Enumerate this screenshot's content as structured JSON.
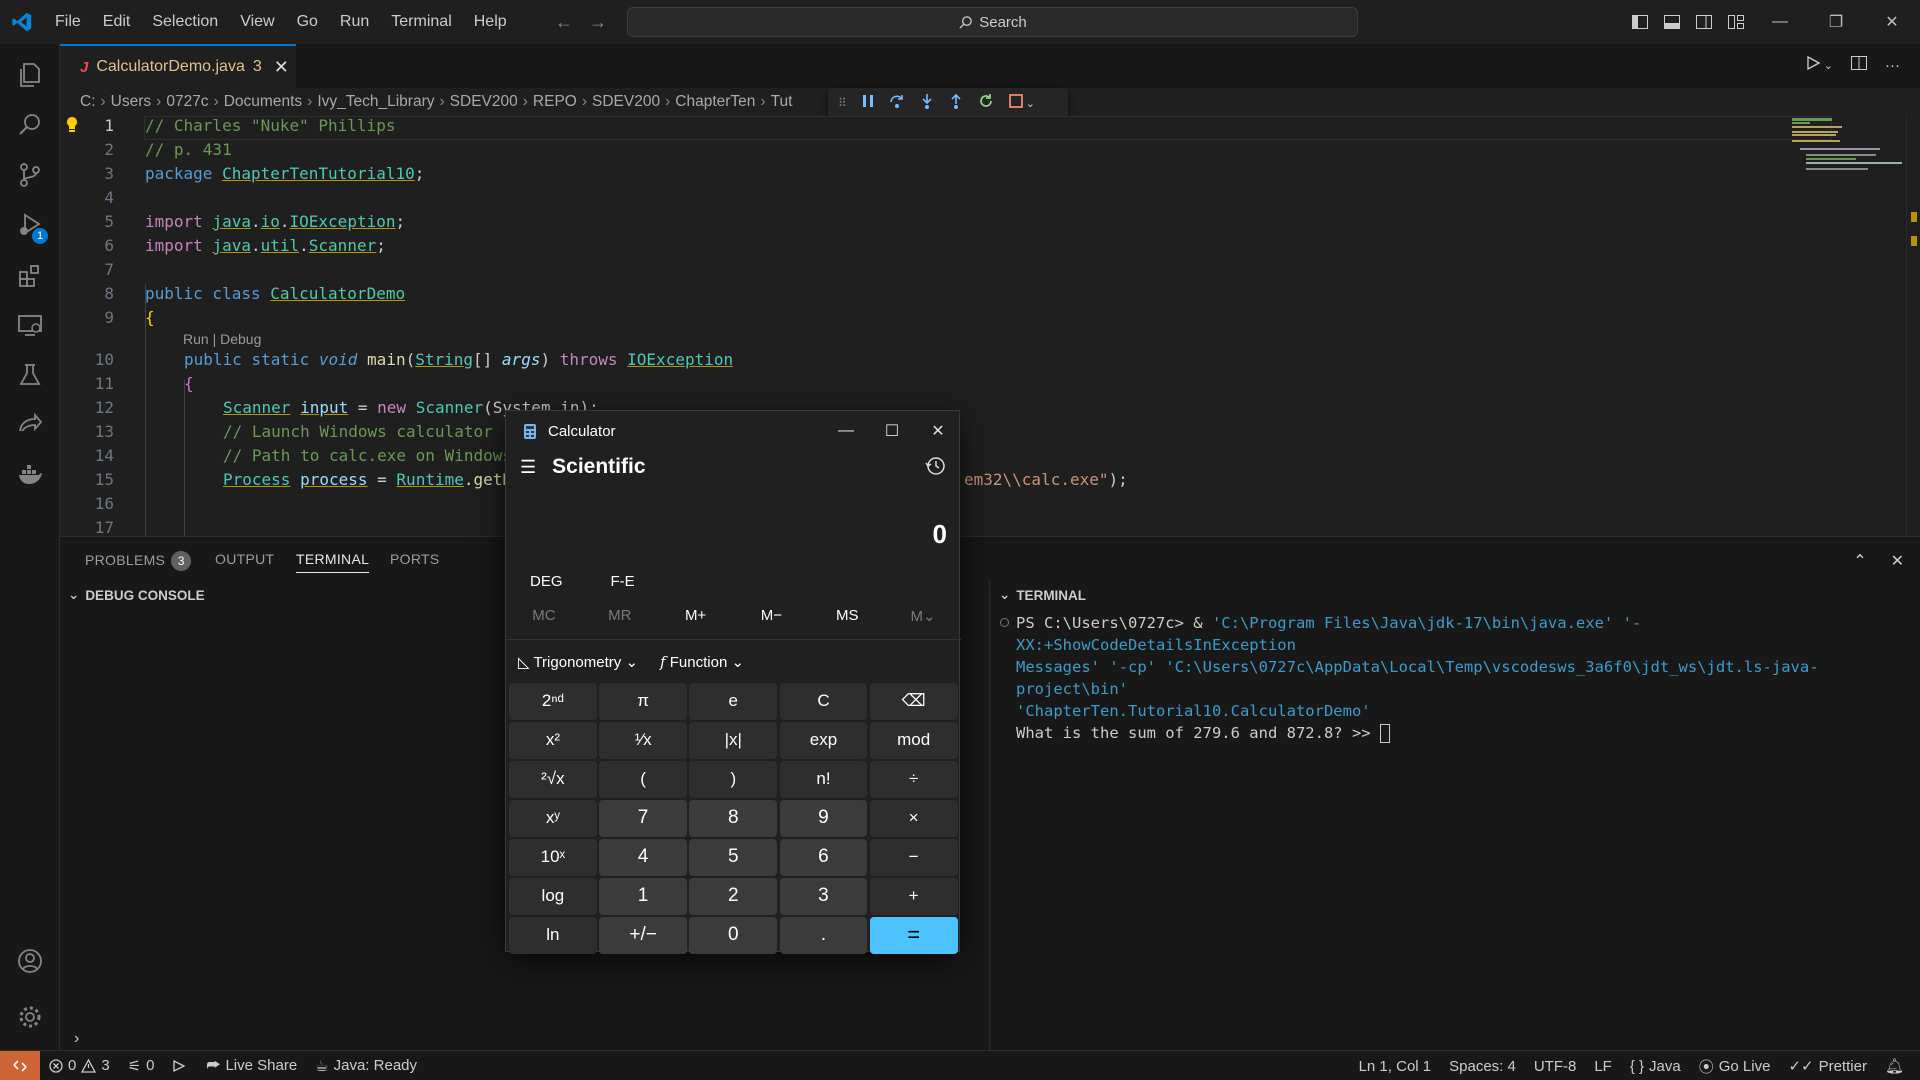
{
  "menu": [
    "File",
    "Edit",
    "Selection",
    "View",
    "Go",
    "Run",
    "Terminal",
    "Help"
  ],
  "search": {
    "label": "Search"
  },
  "activity_badge": "1",
  "tab": {
    "icon": "J",
    "name": "CalculatorDemo.java",
    "problems": "3"
  },
  "breadcrumb": [
    "C:",
    "Users",
    "0727c",
    "Documents",
    "Ivy_Tech_Library",
    "SDEV200",
    "REPO",
    "SDEV200",
    "ChapterTen",
    "Tut"
  ],
  "breadcrumb_tail": "...",
  "editor": {
    "line_numbers": [
      "1",
      "2",
      "3",
      "4",
      "5",
      "6",
      "7",
      "8",
      "9",
      "10",
      "11",
      "12",
      "13",
      "14",
      "15",
      "16",
      "17"
    ],
    "codelens": "Run | Debug",
    "l1": "// Charles \"Nuke\" Phillips",
    "l2": "// p. 431",
    "l3": {
      "kw": "package",
      "a": "ChapterTen",
      ".": ".",
      "b": "Tutorial10",
      ";": ";"
    },
    "l5": {
      "kw": "import",
      "a": "java",
      "b": "io",
      "c": "IOException"
    },
    "l6": {
      "kw": "import",
      "a": "java",
      "b": "util",
      "c": "Scanner"
    },
    "l8": {
      "kw": "public class",
      "a": "CalculatorDemo"
    },
    "l9": "{",
    "l10": {
      "kw": "public static",
      "t": "void",
      "fn": "main",
      "ty": "String",
      "p": "args",
      "th": "throws",
      "ex": "IOException"
    },
    "l11": "{",
    "l12": {
      "ty": "Scanner",
      "v": "input",
      "op": " = ",
      "nw": "new",
      "ty2": "Scanner",
      "arg": "(System.in);"
    },
    "l13": "// Launch Windows calculator",
    "l14": "// Path to calc.exe on Windows",
    "l15": {
      "ty": "Process",
      "v": "process",
      "op": " = ",
      "cls": "Runtime",
      "dot": ".getR",
      "str": "em32\\\\calc.exe\"",
      "end": ");"
    }
  },
  "panel": {
    "tabs": [
      {
        "label": "PROBLEMS",
        "badge": "3"
      },
      {
        "label": "OUTPUT"
      },
      {
        "label": "TERMINAL"
      },
      {
        "label": "PORTS"
      }
    ],
    "debug_console": "DEBUG CONSOLE",
    "terminal_header": "TERMINAL"
  },
  "terminal": {
    "prompt": "PS C:\\Users\\0727c>  & ",
    "java": "'C:\\Program Files\\Java\\jdk-17\\bin\\java.exe'",
    "args1": " '-XX:+ShowCodeDetailsInException",
    "args2": "Messages' '-cp' 'C:\\Users\\0727c\\AppData\\Local\\Temp\\vscodesws_3a6f0\\jdt_ws\\jdt.ls-java-project\\bin'",
    "args3": " 'ChapterTen.Tutorial10.CalculatorDemo'",
    "question": "What is the sum of 279.6 and 872.8? >> "
  },
  "status": {
    "errors": "0",
    "warnings": "3",
    "ports": "0",
    "live_share": "Live Share",
    "java": "Java: Ready",
    "position": "Ln 1, Col 1",
    "spaces": "Spaces: 4",
    "encoding": "UTF-8",
    "eol": "LF",
    "language": "Java",
    "go_live": "Go Live",
    "prettier": "Prettier"
  },
  "calculator": {
    "title": "Calculator",
    "mode": "Scientific",
    "display": "0",
    "angle": "DEG",
    "fe": "F-E",
    "memory": [
      "MC",
      "MR",
      "M+",
      "M−",
      "MS",
      "M⌄"
    ],
    "trig": "Trigonometry",
    "function": "Function",
    "keys": [
      {
        "label": "2ⁿᵈ",
        "kind": "f"
      },
      {
        "label": "π",
        "kind": "f"
      },
      {
        "label": "e",
        "kind": "f"
      },
      {
        "label": "C",
        "kind": "f"
      },
      {
        "label": "⌫",
        "kind": "f"
      },
      {
        "label": "x²",
        "kind": "f"
      },
      {
        "label": "¹⁄x",
        "kind": "f"
      },
      {
        "label": "|x|",
        "kind": "f"
      },
      {
        "label": "exp",
        "kind": "f"
      },
      {
        "label": "mod",
        "kind": "f"
      },
      {
        "label": "²√x",
        "kind": "f"
      },
      {
        "label": "(",
        "kind": "f"
      },
      {
        "label": ")",
        "kind": "f"
      },
      {
        "label": "n!",
        "kind": "f"
      },
      {
        "label": "÷",
        "kind": "f"
      },
      {
        "label": "xʸ",
        "kind": "f"
      },
      {
        "label": "7",
        "kind": "n"
      },
      {
        "label": "8",
        "kind": "n"
      },
      {
        "label": "9",
        "kind": "n"
      },
      {
        "label": "×",
        "kind": "f"
      },
      {
        "label": "10ˣ",
        "kind": "f"
      },
      {
        "label": "4",
        "kind": "n"
      },
      {
        "label": "5",
        "kind": "n"
      },
      {
        "label": "6",
        "kind": "n"
      },
      {
        "label": "−",
        "kind": "f"
      },
      {
        "label": "log",
        "kind": "f"
      },
      {
        "label": "1",
        "kind": "n"
      },
      {
        "label": "2",
        "kind": "n"
      },
      {
        "label": "3",
        "kind": "n"
      },
      {
        "label": "+",
        "kind": "f"
      },
      {
        "label": "ln",
        "kind": "f"
      },
      {
        "label": "+/−",
        "kind": "n"
      },
      {
        "label": "0",
        "kind": "n"
      },
      {
        "label": ".",
        "kind": "n"
      },
      {
        "label": "=",
        "kind": "eq"
      }
    ]
  },
  "colors": {
    "accent": "#0078d4",
    "equals": "#4cc2ff",
    "remote": "#cd6436"
  }
}
